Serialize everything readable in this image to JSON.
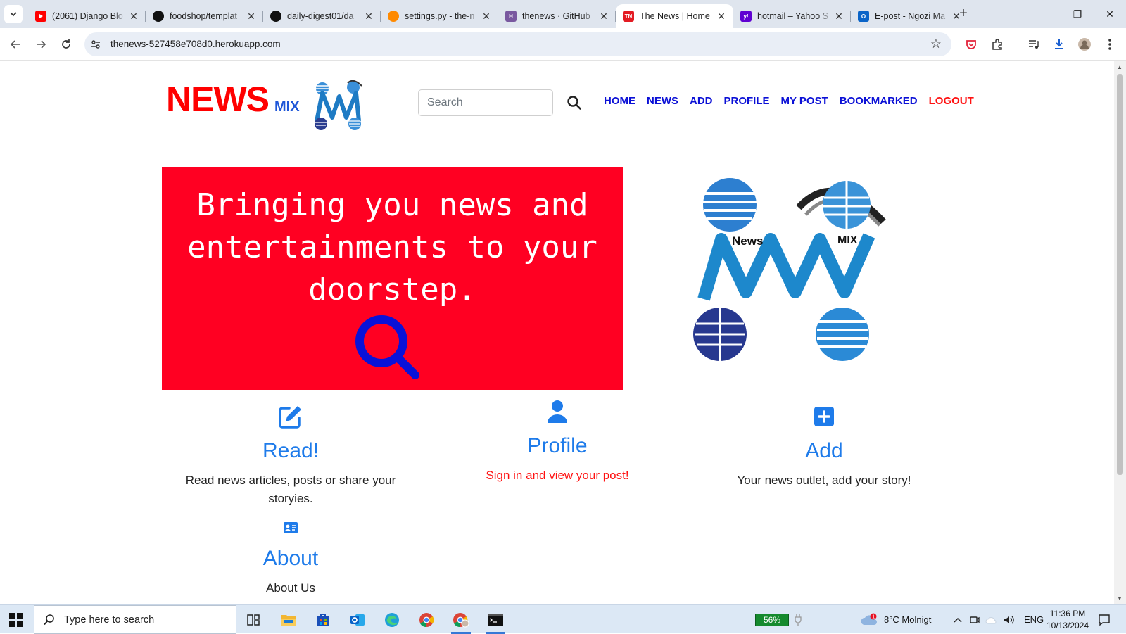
{
  "browser": {
    "tabs": [
      {
        "title": "(2061) Django Blo",
        "favicon": "youtube-icon",
        "color": "#ff0000"
      },
      {
        "title": "foodshop/templat",
        "favicon": "github-icon",
        "color": "#111111"
      },
      {
        "title": "daily-digest01/da",
        "favicon": "github-icon",
        "color": "#111111"
      },
      {
        "title": "settings.py - the-n",
        "favicon": "gitpod-icon",
        "color": "#ff8a00"
      },
      {
        "title": "thenews · GitHub",
        "favicon": "heroku-icon",
        "color": "#79589f"
      },
      {
        "title": "The News | Home",
        "favicon": "tn-icon",
        "color": "#e31b23",
        "active": true,
        "favicon_text": "TN"
      },
      {
        "title": "hotmail – Yahoo S",
        "favicon": "yahoo-icon",
        "color": "#6001d2",
        "favicon_text": "y!"
      },
      {
        "title": "E-post - Ngozi Ma",
        "favicon": "outlook-icon",
        "color": "#0a64c8",
        "favicon_text": "O"
      }
    ],
    "url": "thenews-527458e708d0.herokuapp.com"
  },
  "page": {
    "brand_main": "NEWS",
    "brand_sub": "MIX",
    "search_placeholder": "Search",
    "nav": [
      "HOME",
      "NEWS",
      "ADD",
      "PROFILE",
      "MY POST",
      "BOOKMARKED",
      "LOGOUT"
    ],
    "hero_text": "Bringing you news and entertainments to your doorstep.",
    "logo_text_left": "News",
    "logo_text_right": "MIX",
    "cards": [
      {
        "title": "Read!",
        "text": "Read news articles, posts or share your storyies.",
        "icon": "edit-icon"
      },
      {
        "title": "Profile",
        "text": "Sign in and view your post!",
        "icon": "user-icon"
      },
      {
        "title": "Add",
        "text": "Your news outlet, add your story!",
        "icon": "plus-square-icon"
      },
      {
        "title": "About",
        "text": "About Us",
        "icon": "id-card-icon"
      }
    ]
  },
  "taskbar": {
    "search_placeholder": "Type here to search",
    "battery": "56%",
    "weather": "8°C  Molnigt",
    "language": "ENG",
    "time": "11:36 PM",
    "date": "10/13/2024"
  },
  "colors": {
    "brand_red": "#ff0000",
    "nav_blue": "#0b10d6",
    "hero_bg": "#ff0022",
    "card_blue": "#1e7bea"
  }
}
